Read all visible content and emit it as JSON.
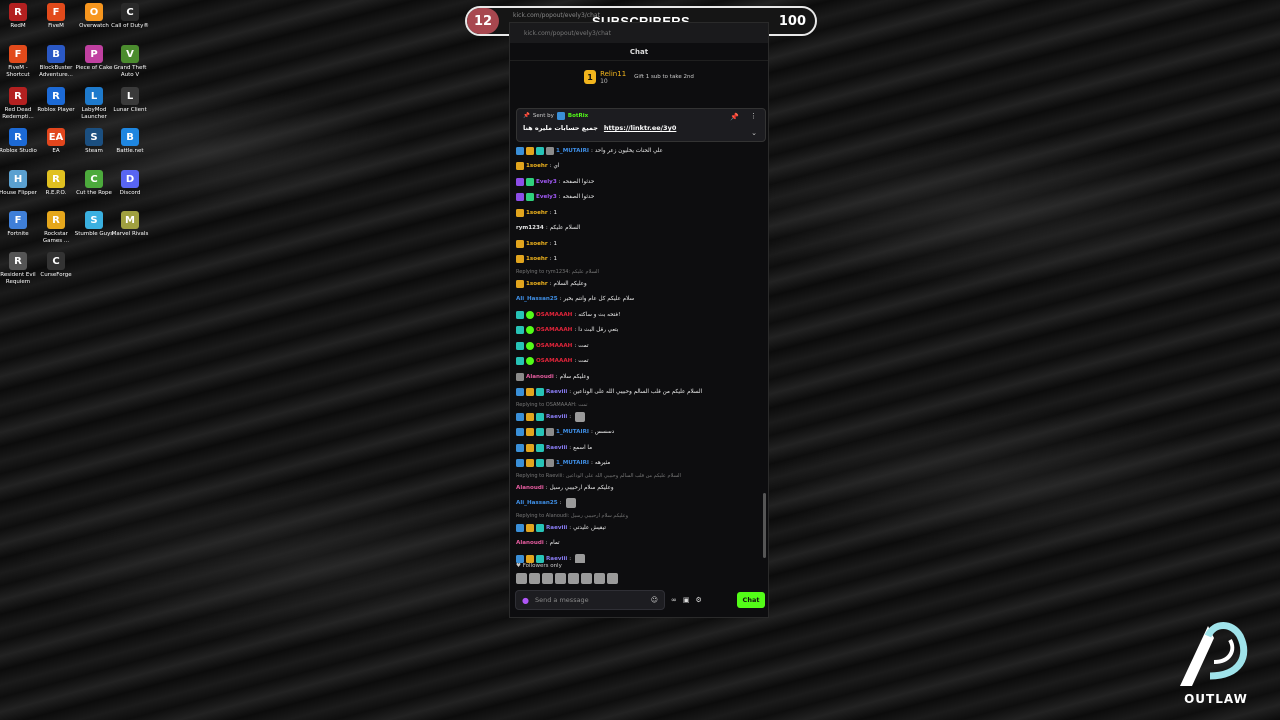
{
  "desktop": {
    "icons": [
      {
        "label": "RedM",
        "color": "#b32020",
        "glyph": "R"
      },
      {
        "label": "FiveM",
        "color": "#e24a1b",
        "glyph": "F"
      },
      {
        "label": "Overwatch",
        "color": "#f7961e",
        "glyph": "O"
      },
      {
        "label": "Call of Duty®",
        "color": "#2a2a2a",
        "glyph": "C"
      },
      {
        "label": "FiveM - Shortcut",
        "color": "#e24a1b",
        "glyph": "F"
      },
      {
        "label": "BlockBuster Adventure...",
        "color": "#2a58c4",
        "glyph": "B"
      },
      {
        "label": "Piece of Cake",
        "color": "#c040a0",
        "glyph": "P"
      },
      {
        "label": "Grand Theft Auto V",
        "color": "#4b8c2e",
        "glyph": "V"
      },
      {
        "label": "Red Dead Redempti...",
        "color": "#b32020",
        "glyph": "R"
      },
      {
        "label": "Roblox Player",
        "color": "#1c6ad6",
        "glyph": "R"
      },
      {
        "label": "LabyMod Launcher",
        "color": "#1e7acc",
        "glyph": "L"
      },
      {
        "label": "Lunar Client",
        "color": "#3a3a3a",
        "glyph": "L"
      },
      {
        "label": "Roblox Studio",
        "color": "#1c6ad6",
        "glyph": "R"
      },
      {
        "label": "EA",
        "color": "#e2461d",
        "glyph": "EA"
      },
      {
        "label": "Steam",
        "color": "#1b4f80",
        "glyph": "S"
      },
      {
        "label": "Battle.net",
        "color": "#1e86e0",
        "glyph": "B"
      },
      {
        "label": "House Flipper",
        "color": "#5aa0d0",
        "glyph": "H"
      },
      {
        "label": "R.E.P.O.",
        "color": "#e0c020",
        "glyph": "R"
      },
      {
        "label": "Cut the Rope",
        "color": "#4caa3c",
        "glyph": "C"
      },
      {
        "label": "Discord",
        "color": "#5865f2",
        "glyph": "D"
      },
      {
        "label": "Fortnite",
        "color": "#3f7fd8",
        "glyph": "F"
      },
      {
        "label": "Rockstar Games ...",
        "color": "#e6a71c",
        "glyph": "R"
      },
      {
        "label": "Stumble Guys",
        "color": "#3ab0e0",
        "glyph": "S"
      },
      {
        "label": "Marvel Rivals",
        "color": "#a0a040",
        "glyph": "M"
      },
      {
        "label": "Resident Evil Requiem",
        "color": "#555",
        "glyph": "R"
      },
      {
        "label": "CurseForge",
        "color": "#333",
        "glyph": "C"
      }
    ]
  },
  "subscribers": {
    "current": "12",
    "title": "SUBSCRIBERS",
    "goal": "100",
    "ghost_url": "kick.com/popout/evely3/chat"
  },
  "browser": {
    "url": "kick.com/popout/evely3/chat",
    "title": "Chat"
  },
  "gifter": {
    "rank": "1",
    "name": "Relin11",
    "count": "10",
    "info": "Gift 1 sub to take 2nd"
  },
  "pinned": {
    "sent_by": "Sent by",
    "bot_name": "BotRix",
    "text": "جميع حسابات مليره هنا",
    "link": "https://linktr.ee/3y0"
  },
  "messages": [
    {
      "badges": [
        "blue",
        "gold",
        "teal",
        "gray"
      ],
      "user": "1_MUTAIRI",
      "color": "#3f8fe6",
      "text": "علي الحنات يخليون زعر واحد"
    },
    {
      "badges": [
        "gold"
      ],
      "user": "1soehr",
      "color": "#f2b51d",
      "text": "اي"
    },
    {
      "badges": [
        "purple",
        "green"
      ],
      "user": "Evely3",
      "color": "#a259f7",
      "text": "حدثوا الصفحه"
    },
    {
      "badges": [
        "purple",
        "green"
      ],
      "user": "Evely3",
      "color": "#a259f7",
      "text": "حدثوا الصفحه"
    },
    {
      "badges": [
        "gold"
      ],
      "user": "1soehr",
      "color": "#f2b51d",
      "text": "1"
    },
    {
      "badges": [],
      "user": "rym1234",
      "color": "#e6e6e6",
      "text": "السلام عليكم"
    },
    {
      "badges": [
        "gold"
      ],
      "user": "1soehr",
      "color": "#f2b51d",
      "text": "1"
    },
    {
      "badges": [
        "gold"
      ],
      "user": "1soehr",
      "color": "#f2b51d",
      "text": "1"
    },
    {
      "reply": "Replying to rym1234: السلام عليكم"
    },
    {
      "badges": [
        "gold"
      ],
      "user": "1soehr",
      "color": "#f2b51d",
      "text": "وعليكم السلام"
    },
    {
      "badges": [],
      "user": "Ali_Hassan25",
      "color": "#3f8fe6",
      "text": "سلام عليكم كل عام وانتم بخير"
    },
    {
      "badges": [
        "teal",
        "verif"
      ],
      "user": "OSAMAAAH",
      "color": "#e0243a",
      "text": "فتحه بث و ساكته!"
    },
    {
      "badges": [
        "teal",
        "verif"
      ],
      "user": "OSAMAAAH",
      "color": "#e0243a",
      "text": "بتعي رقل البث دا"
    },
    {
      "badges": [
        "teal",
        "verif"
      ],
      "user": "OSAMAAAH",
      "color": "#e0243a",
      "text": "تمت"
    },
    {
      "badges": [
        "teal",
        "verif"
      ],
      "user": "OSAMAAAH",
      "color": "#e0243a",
      "text": "تمت"
    },
    {
      "badges": [
        "gray"
      ],
      "user": "Alanoudi",
      "color": "#e65ca0",
      "text": "وعليكم سلام"
    },
    {
      "badges": [
        "blue",
        "gold",
        "teal"
      ],
      "user": "Raeviii",
      "color": "#8a7df5",
      "text": "السلام عليكم من قلب السالم وحبيبي الله على الوداعين"
    },
    {
      "reply": "Replying to OSAMAAAH: تمت"
    },
    {
      "badges": [
        "blue",
        "gold",
        "teal"
      ],
      "user": "Raeviii",
      "color": "#8a7df5",
      "text": ""
    },
    {
      "badges": [
        "blue",
        "gold",
        "teal",
        "gray"
      ],
      "user": "1_MUTAIRI",
      "color": "#3f8fe6",
      "text": "دسسس"
    },
    {
      "badges": [
        "blue",
        "gold",
        "teal"
      ],
      "user": "Raeviii",
      "color": "#8a7df5",
      "text": "ما اسمع"
    },
    {
      "badges": [
        "blue",
        "gold",
        "teal",
        "gray"
      ],
      "user": "1_MUTAIRI",
      "color": "#3f8fe6",
      "text": "مثيرهه"
    },
    {
      "reply": "Replying to Raeviii: السلام عليكم من قلب السالم وحبيبي الله على الوداعين"
    },
    {
      "badges": [],
      "user": "Alanoudi",
      "color": "#e65ca0",
      "text": "وعليكم سلام ارحبيبي رسيل"
    },
    {
      "badges": [],
      "user": "Ali_Hassan25",
      "color": "#3f8fe6",
      "text": ""
    },
    {
      "reply": "Replying to Alanoudi: وعليكم سلام ارحبيبي رسيل"
    },
    {
      "badges": [
        "blue",
        "gold",
        "teal"
      ],
      "user": "Raeviii",
      "color": "#8a7df5",
      "text": "تيقيش عليدتي"
    },
    {
      "badges": [],
      "user": "Alanoudi",
      "color": "#e65ca0",
      "text": "تمام"
    },
    {
      "badges": [
        "blue",
        "gold",
        "teal"
      ],
      "user": "Raeviii",
      "color": "#8a7df5",
      "text": ""
    }
  ],
  "footer": {
    "followers_only": "Followers only",
    "placeholder": "Send a message",
    "chat_button": "Chat"
  },
  "logo": {
    "word": "OUTLAW"
  }
}
